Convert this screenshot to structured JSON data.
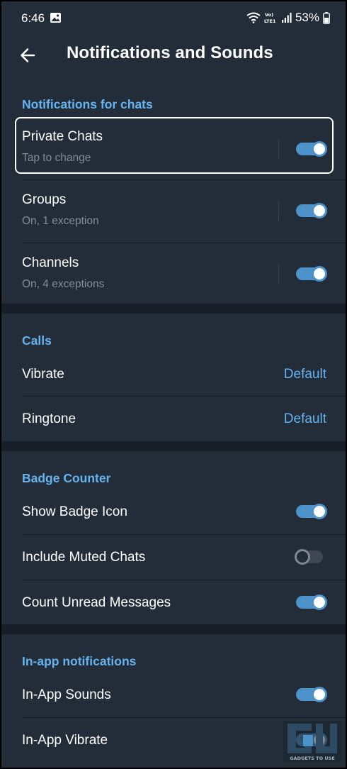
{
  "status_bar": {
    "time": "6:46",
    "network_label": "Vo) LTE1",
    "battery": "53%"
  },
  "app_bar": {
    "title": "Notifications and Sounds",
    "back_icon": "arrow-left-icon"
  },
  "notifications_for_chats": {
    "header": "Notifications for chats",
    "items": [
      {
        "label": "Private Chats",
        "sub": "Tap to change",
        "enabled": true
      },
      {
        "label": "Groups",
        "sub": "On, 1 exception",
        "enabled": true
      },
      {
        "label": "Channels",
        "sub": "On, 4 exceptions",
        "enabled": true
      }
    ]
  },
  "calls": {
    "header": "Calls",
    "items": [
      {
        "label": "Vibrate",
        "value": "Default"
      },
      {
        "label": "Ringtone",
        "value": "Default"
      }
    ]
  },
  "badge_counter": {
    "header": "Badge Counter",
    "items": [
      {
        "label": "Show Badge Icon",
        "enabled": true
      },
      {
        "label": "Include Muted Chats",
        "enabled": false
      },
      {
        "label": "Count Unread Messages",
        "enabled": true
      }
    ]
  },
  "in_app_notifications": {
    "header": "In-app notifications",
    "items": [
      {
        "label": "In-App Sounds",
        "enabled": true
      },
      {
        "label": "In-App Vibrate",
        "enabled": true
      }
    ]
  },
  "watermark": {
    "text": "GADGETS TO USE"
  },
  "colors": {
    "accent": "#65b3ef",
    "toggle_on": "#4d93c9",
    "background": "#232d39",
    "band": "#171e27"
  }
}
